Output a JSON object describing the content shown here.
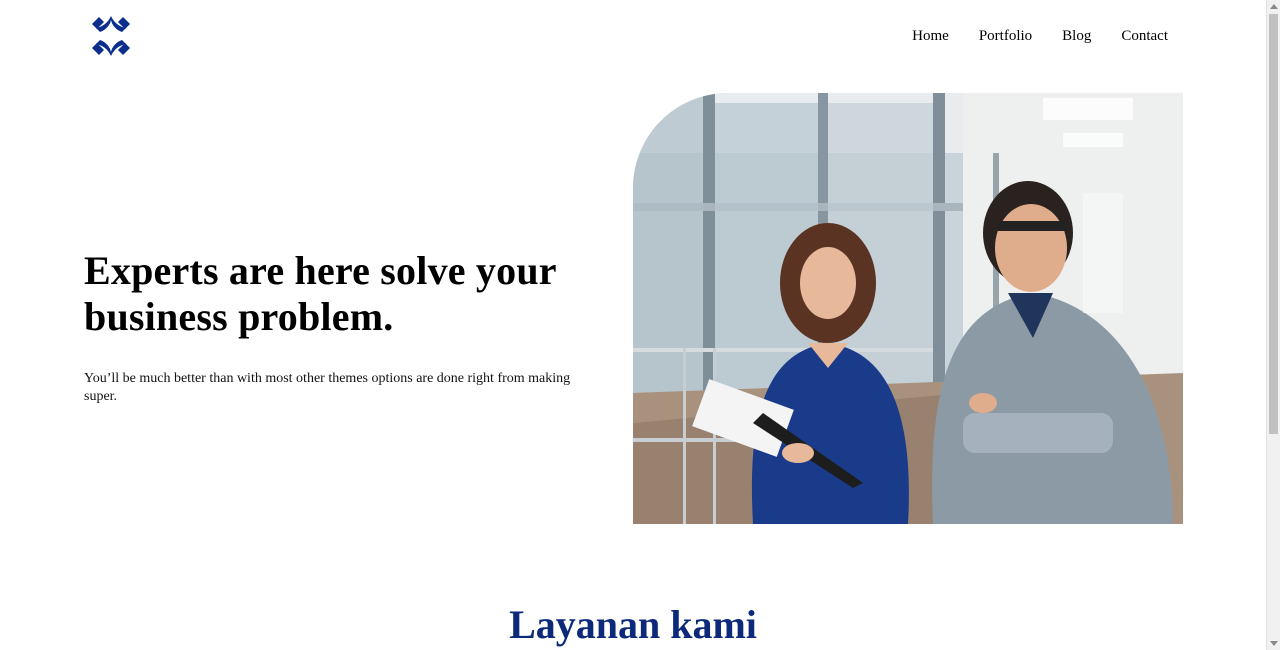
{
  "header": {
    "logo_icon": "four-arc-logo-icon",
    "nav": [
      {
        "label": "Home"
      },
      {
        "label": "Portfolio"
      },
      {
        "label": "Blog"
      },
      {
        "label": "Contact"
      }
    ]
  },
  "hero": {
    "title": "Experts are here solve your business problem.",
    "subtitle": "You’ll be much better than with most other themes options are done right from making super.",
    "image": "business-people-photo"
  },
  "services": {
    "title": "Layanan kami"
  },
  "colors": {
    "brand": "#0d2a7a",
    "logo": "#0a2e8c",
    "text": "#000000",
    "background": "#ffffff"
  }
}
